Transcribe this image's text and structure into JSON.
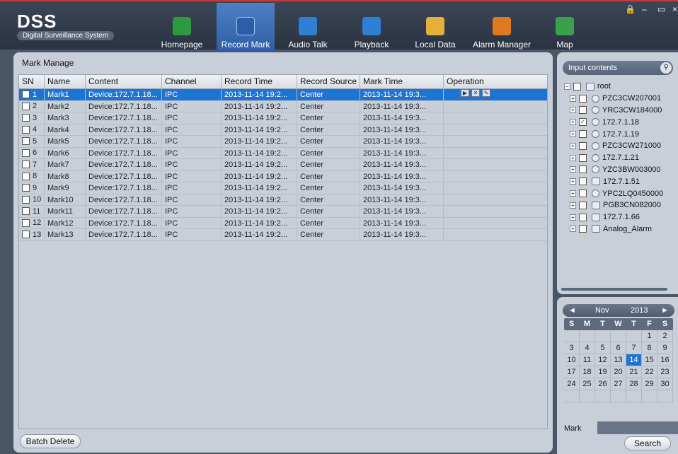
{
  "app": {
    "name": "DSS",
    "subtitle": "Digital Surveillance System"
  },
  "nav": [
    {
      "label": "Homepage",
      "icon": "home-icon",
      "color": "#2e9a3e"
    },
    {
      "label": "Record Mark",
      "icon": "record-mark-icon",
      "color": "#3060a8",
      "active": true
    },
    {
      "label": "Audio Talk",
      "icon": "microphone-icon",
      "color": "#2f7fd5"
    },
    {
      "label": "Playback",
      "icon": "playback-icon",
      "color": "#2f7fd5"
    },
    {
      "label": "Local Data",
      "icon": "folder-icon",
      "color": "#e3b13a"
    },
    {
      "label": "Alarm Manager",
      "icon": "alarm-icon",
      "color": "#e07a1f"
    },
    {
      "label": "Map",
      "icon": "map-icon",
      "color": "#3aa14a"
    }
  ],
  "window_controls": {
    "lock": "🔒",
    "minimize": "–",
    "maximize": "▭",
    "close": "×"
  },
  "panel": {
    "title": "Mark Manage"
  },
  "table": {
    "columns": [
      "SN",
      "Name",
      "Content",
      "Channel",
      "Record Time",
      "Record Source",
      "Mark Time",
      "Operation"
    ],
    "rows": [
      {
        "sn": "1",
        "name": "Mark1",
        "content": "Device:172.7.1.18...",
        "channel": "IPC",
        "record_time": "2013-11-14 19:2...",
        "source": "Center",
        "mark_time": "2013-11-14 19:3..."
      },
      {
        "sn": "2",
        "name": "Mark2",
        "content": "Device:172.7.1.18...",
        "channel": "IPC",
        "record_time": "2013-11-14 19:2...",
        "source": "Center",
        "mark_time": "2013-11-14 19:3..."
      },
      {
        "sn": "3",
        "name": "Mark3",
        "content": "Device:172.7.1.18...",
        "channel": "IPC",
        "record_time": "2013-11-14 19:2...",
        "source": "Center",
        "mark_time": "2013-11-14 19:3..."
      },
      {
        "sn": "4",
        "name": "Mark4",
        "content": "Device:172.7.1.18...",
        "channel": "IPC",
        "record_time": "2013-11-14 19:2...",
        "source": "Center",
        "mark_time": "2013-11-14 19:3..."
      },
      {
        "sn": "5",
        "name": "Mark5",
        "content": "Device:172.7.1.18...",
        "channel": "IPC",
        "record_time": "2013-11-14 19:2...",
        "source": "Center",
        "mark_time": "2013-11-14 19:3..."
      },
      {
        "sn": "6",
        "name": "Mark6",
        "content": "Device:172.7.1.18...",
        "channel": "IPC",
        "record_time": "2013-11-14 19:2...",
        "source": "Center",
        "mark_time": "2013-11-14 19:3..."
      },
      {
        "sn": "7",
        "name": "Mark7",
        "content": "Device:172.7.1.18...",
        "channel": "IPC",
        "record_time": "2013-11-14 19:2...",
        "source": "Center",
        "mark_time": "2013-11-14 19:3..."
      },
      {
        "sn": "8",
        "name": "Mark8",
        "content": "Device:172.7.1.18...",
        "channel": "IPC",
        "record_time": "2013-11-14 19:2...",
        "source": "Center",
        "mark_time": "2013-11-14 19:3..."
      },
      {
        "sn": "9",
        "name": "Mark9",
        "content": "Device:172.7.1.18...",
        "channel": "IPC",
        "record_time": "2013-11-14 19:2...",
        "source": "Center",
        "mark_time": "2013-11-14 19:3..."
      },
      {
        "sn": "10",
        "name": "Mark10",
        "content": "Device:172.7.1.18...",
        "channel": "IPC",
        "record_time": "2013-11-14 19:2...",
        "source": "Center",
        "mark_time": "2013-11-14 19:3..."
      },
      {
        "sn": "11",
        "name": "Mark11",
        "content": "Device:172.7.1.18...",
        "channel": "IPC",
        "record_time": "2013-11-14 19:2...",
        "source": "Center",
        "mark_time": "2013-11-14 19:3..."
      },
      {
        "sn": "12",
        "name": "Mark12",
        "content": "Device:172.7.1.18...",
        "channel": "IPC",
        "record_time": "2013-11-14 19:2...",
        "source": "Center",
        "mark_time": "2013-11-14 19:3..."
      },
      {
        "sn": "13",
        "name": "Mark13",
        "content": "Device:172.7.1.18...",
        "channel": "IPC",
        "record_time": "2013-11-14 19:2...",
        "source": "Center",
        "mark_time": "2013-11-14 19:3..."
      }
    ],
    "selected_row": "1",
    "operation_icons": [
      "play-icon",
      "delete-icon",
      "edit-icon"
    ],
    "selection_color": "#1f73d1"
  },
  "buttons": {
    "batch_delete": "Batch Delete",
    "search": "Search"
  },
  "tree": {
    "search_placeholder": "Input contents",
    "root": "root",
    "nodes": [
      {
        "label": "PZC3CW207001",
        "icon": "camera-icon",
        "checked": false
      },
      {
        "label": "YRC3CW184000",
        "icon": "camera-icon",
        "checked": false
      },
      {
        "label": "172.7.1.18",
        "icon": "camera-icon",
        "checked": true
      },
      {
        "label": "172.7.1.19",
        "icon": "camera-icon",
        "checked": false
      },
      {
        "label": "PZC3CW271000",
        "icon": "camera-icon",
        "checked": false
      },
      {
        "label": "172.7.1.21",
        "icon": "camera-icon",
        "checked": false
      },
      {
        "label": "YZC3BW003000",
        "icon": "camera-icon",
        "checked": false
      },
      {
        "label": "172.7.1.51",
        "icon": "nvr-icon",
        "checked": false
      },
      {
        "label": "YPC2LQ0450000",
        "icon": "camera-icon",
        "checked": false
      },
      {
        "label": "PGB3CN082000",
        "icon": "nvr-icon",
        "checked": false
      },
      {
        "label": "172.7.1.66",
        "icon": "nvr-icon",
        "checked": false
      },
      {
        "label": "Analog_Alarm",
        "icon": "nvr-icon",
        "checked": false
      }
    ]
  },
  "calendar": {
    "month": "Nov",
    "year": "2013",
    "prev": "◄",
    "next": "►",
    "weekdays": [
      "S",
      "M",
      "T",
      "W",
      "T",
      "F",
      "S"
    ],
    "weeks": [
      [
        "",
        "",
        "",
        "",
        "",
        "1",
        "2"
      ],
      [
        "3",
        "4",
        "5",
        "6",
        "7",
        "8",
        "9"
      ],
      [
        "10",
        "11",
        "12",
        "13",
        "14",
        "15",
        "16"
      ],
      [
        "17",
        "18",
        "19",
        "20",
        "21",
        "22",
        "23"
      ],
      [
        "24",
        "25",
        "26",
        "27",
        "28",
        "29",
        "30"
      ],
      [
        "",
        "",
        "",
        "",
        "",
        "",
        ""
      ]
    ],
    "today": "14",
    "mark_label": "Mark",
    "mark_value": ""
  }
}
